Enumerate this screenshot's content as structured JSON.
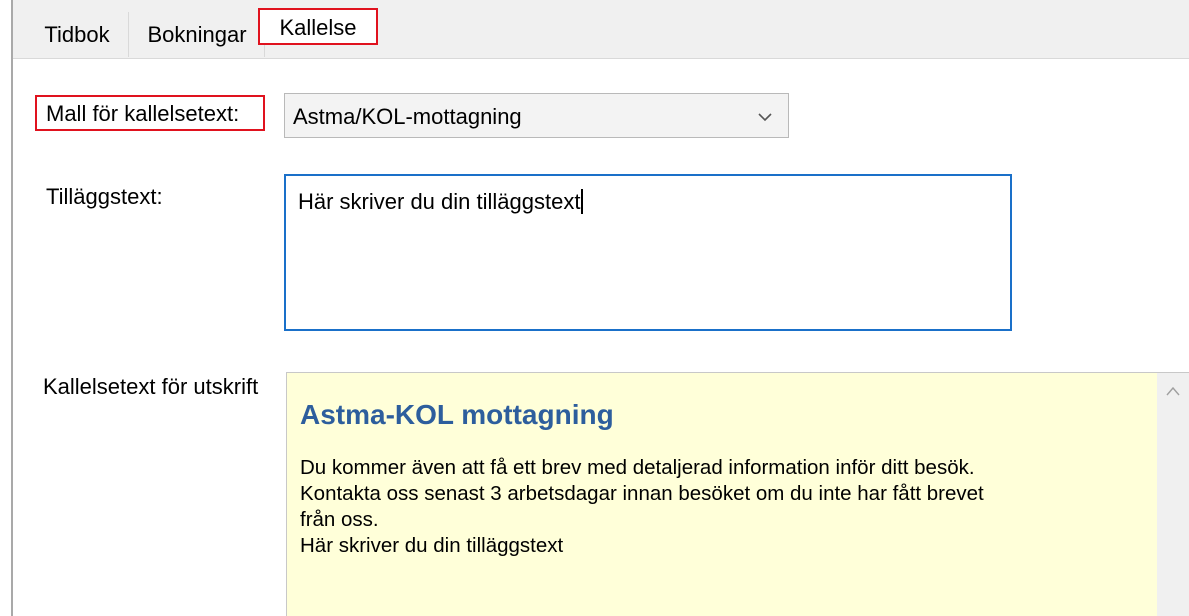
{
  "tabs": [
    {
      "label": "Tidbok"
    },
    {
      "label": "Bokningar"
    },
    {
      "label": "Kallelse",
      "active": true
    }
  ],
  "form": {
    "template_label": "Mall för kallelsetext:",
    "template_value": "Astma/KOL-mottagning",
    "additional_label": "Tilläggstext:",
    "additional_value": "Här skriver du din tilläggstext",
    "print_label": "Kallelsetext för utskrift"
  },
  "preview": {
    "heading": "Astma-KOL mottagning",
    "lines": [
      "Du kommer även att få ett brev med detaljerad information inför ditt besök.",
      "Kontakta oss senast 3 arbetsdagar innan besöket om du inte har fått brevet",
      "från oss.",
      "Här skriver du din tilläggstext"
    ]
  },
  "colors": {
    "highlight_border": "#e0121e",
    "focus_border": "#1a70c9",
    "preview_background": "#ffffd9",
    "heading_color": "#2d5e9d"
  },
  "icons": {
    "select_chevron": "chevron-down-icon",
    "scroll_up": "chevron-up-icon"
  }
}
